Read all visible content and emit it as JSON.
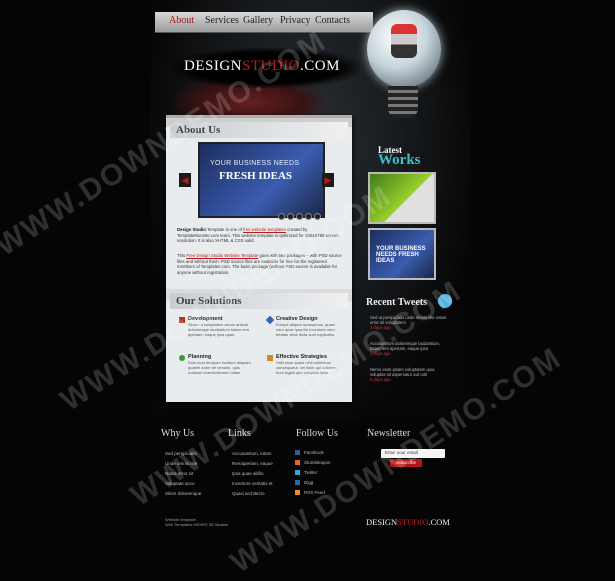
{
  "nav": {
    "items": [
      {
        "label": "About",
        "active": true
      },
      {
        "label": "Services"
      },
      {
        "label": "Gallery"
      },
      {
        "label": "Privacy"
      },
      {
        "label": "Contacts"
      }
    ]
  },
  "logo": {
    "part1": "DESIGN",
    "part2": "STUDIO",
    "part3": ".COM",
    "part2_color": "#c01818"
  },
  "about": {
    "title": "About Us",
    "banner_line1": "YOUR BUSINESS NEEDS",
    "banner_line2": "FRESH IDEAS",
    "para1_bold": "Design Studio",
    "para1_a": " Template is one of ",
    "para1_link": "free website templates",
    "para1_b": " created by TemplateMonster.com team. This website template is optimized for 1024X768 screen resolution. It is also XHTML & CSS valid.",
    "para2_a": "This ",
    "para2_link": "Free Design Studio Website Template",
    "para2_b": " goes with two packages – with PSD source files and without them. PSD source files are available for free for the registered members of Templates.com. The basic package (without PSD source is available for anyone without registration."
  },
  "solutions": {
    "title": "Our Solutions",
    "items": [
      {
        "title": "Development",
        "desc": "Sinun ut voluptatem accus antium doloremque laudantium totam rem aperiam, eaque ipsa quae."
      },
      {
        "title": "Creative Design",
        "desc": "Eumpe aliquot accusamus, quasi nam quae ipsa illo inventore vero beatae vitae dicta sunt explicabo."
      },
      {
        "title": "Planning",
        "desc": "Duis mod tempore incidunt aliquam quaerit anim vel veniam, quis nostrum exercitationem ullam."
      },
      {
        "title": "Effective Strategies",
        "desc": "Velit esse quam nihil molestiae consequatur, vel illum qui dolorem eum fugiat quo voluptas nulla."
      }
    ],
    "icon_colors": [
      "#b8331c",
      "#2f64b7",
      "#3d9a2e",
      "#d48a1e"
    ]
  },
  "works": {
    "title_a": "Latest",
    "title_b": "Works",
    "thumb2_text": "YOUR BUSINESS NEEDS FRESH IDEAS"
  },
  "tweets": {
    "title": "Recent Tweets",
    "items": [
      {
        "text": "Sed ut perspiciatis unde omnis iste natus error sit voluptatem",
        "meta": "3 days ago"
      },
      {
        "text": "Accusantium doloremque laudantium, totam rem aperiam, eaque ipsa",
        "meta": "4 days ago"
      },
      {
        "text": "Nemo enim ipsam voluptatem quia voluptas sit aspernatur aut odit",
        "meta": "5 days ago"
      }
    ]
  },
  "watermark": "WWW.DOWNDEMO.COM",
  "footer": {
    "why_title": "Why Us",
    "why_items": [
      "Sed perspiciatis",
      "Unde omnis iste",
      "Natus error sit",
      "Voluptate accu",
      "Silum doloremque"
    ],
    "links_title": "Links",
    "links_items": [
      "Accusantium, totam",
      "Remaperiam, eaque",
      "Ipsa quae abillo",
      "Inventore veritatis et",
      "Quasi architecto"
    ],
    "follow_title": "Follow Us",
    "follow_items": [
      "Facebook",
      "Stumbleupon",
      "Twitter",
      "Digg",
      "RSS Feed"
    ],
    "follow_colors": [
      "#3b5998",
      "#e6662f",
      "#35a4d9",
      "#2d68a9",
      "#f08a24"
    ],
    "newsletter_title": "Newsletter",
    "newsletter_placeholder": "Enter your email",
    "subscribe_label": "Subscribe",
    "copyright_1": "Website template",
    "copyright_2": "Web Templates МЕНЕЕ 3D Models"
  }
}
